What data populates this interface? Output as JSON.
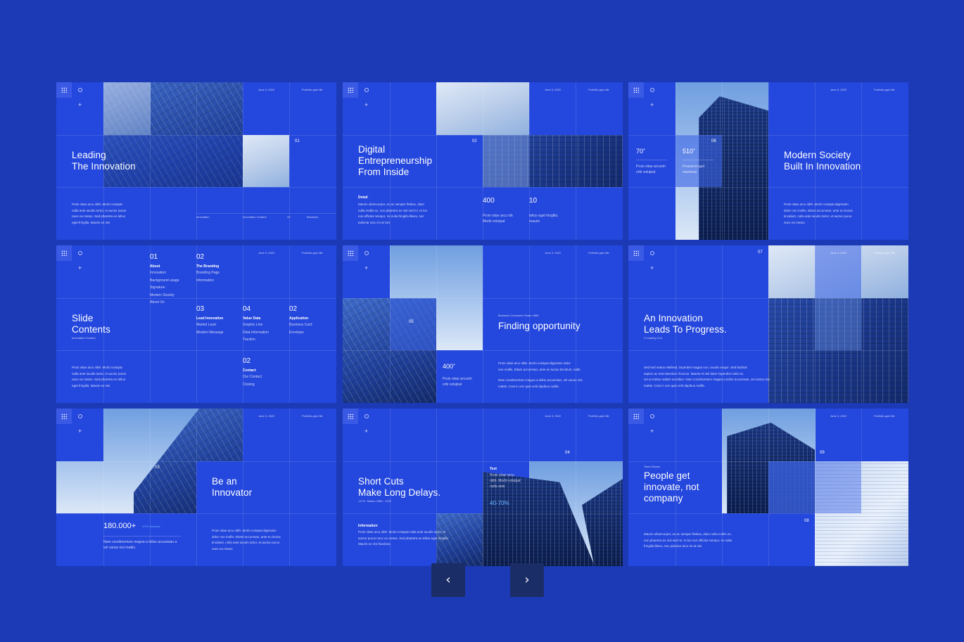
{
  "slides_common": {
    "date": "June 3, 2022",
    "file": "Portfolio.pptx file"
  },
  "slide1": {
    "title": "Leading\nThe Innovation",
    "num": "01",
    "body": "Proin vitae arcu nibh. Morbi volutpat\nnulla ante iaculis tortor, et auctor purus\nnunc eu metus. Sed pharetra eu tellus\neget fringilla. Mauris ex nisi",
    "footer": [
      "Innovation",
      "Innovation Content",
      "33",
      "Business"
    ]
  },
  "slide2": {
    "title": "Digital\nEntrepreneurship\nFrom Inside",
    "num": "02",
    "label": "Detail",
    "body": "Mauris ullamcorper, ex ac semper finibus, diam\nnulla mollis ex, non pharetra ex nisl sed mi. In leo\nnon efficitur tempor, mi nulla fringilla libero, nec\npulvinar arcu mi at nisi.",
    "stat1": "400",
    "stat1_text": "Proin vitae arcu nib\nMorbi volutpat",
    "stat2": "10",
    "stat2_text": "tellus eget fringilla.\nmauris"
  },
  "slide3": {
    "title": "Modern Society\nBuilt In Innovation",
    "num": "06",
    "stat1": "70",
    "stat1_text": "Proin vitae arcurnh\norbi volutpat",
    "stat2": "510",
    "stat2_text": "Praesent eget\nmaximus",
    "body": "Proin vitae arcu nibh. Morbi volutpat dignissim\ndolor non mollis. Etiam accumsan, ante eu luctus\ntincidunt, nulla ante iaculis tortor, et auctor purus\nnunc eu metus."
  },
  "slide4": {
    "title": "Slide\nContents",
    "subtitle": "Innovation Content",
    "body": "Proin vitae arcu nibh. Morbi volutpat\nnulla ante iaculis tortor, et auctor purus\nnunc eu metus. Sed pharetra eu tellus\neget fringilla. Mauris ex nisi",
    "toc": [
      {
        "num": "01",
        "head": "About",
        "items": "Innovation\nBackground usage\nSignature\nModern Society\nAbout Us"
      },
      {
        "num": "02",
        "head": "The Branding",
        "items": "Branding Page\nInformation"
      },
      {
        "num": "03",
        "head": "Lead Innovation",
        "items": "Market Lead\nModern Message"
      },
      {
        "num": "04",
        "head": "Value Data",
        "items": "Graphic Line\nData Information\nTraction"
      },
      {
        "num": "02",
        "head": "Application",
        "items": "Business Card\nEnvelope"
      },
      {
        "num": "02",
        "head": "Contact",
        "items": "Our Contact\nClosing"
      }
    ]
  },
  "slide5": {
    "title": "Finding opportunity",
    "kicker": "Business Consumer Share 1880",
    "num": "05",
    "stat": "400",
    "stat_text": "Proin vitae arcurnh\norbi volutpat",
    "body1": "Proin vitae arcu nibh. Morbi volutpat dignissim dolor\nnon mollis. Etiam accumsan, ante eu luctus tincidunt, nulla",
    "body2": "Nam condimentum magna a tellus accumsan, vel varius nisi\nmattis. Cras in orci quis velit dapibus mollis."
  },
  "slide6": {
    "title": "An Innovation\nLeads To Progress.",
    "subtitle": "// Leading 1111",
    "num": "07",
    "body": "Sed sed metus eleifend, imperdiet magna non, iaculis neque. Sed facilisis\nsapien ac erat interdum rhoncus. Mauris et nisl diam imperdiet nulla eu\nvel ut metus nullam eu tellus. Nam condimentum magna a tellus accumsan, vel varius nisi\nmattis. Cras in orci quis velit dapibus mollis."
  },
  "slide7": {
    "title": "Be an\nInnovator",
    "num": "03",
    "stat": "180.000+",
    "stat_note": "+27% Increase",
    "stat_text": "Nam condimentum magna a tellus accumsan a\nvel varius nisi mattis.",
    "body": "Proin vitae arcu nibh. Morbi volutpat dignissim\ndolor non mollis. Etiam accumsan, ante eu luctus\ntincidunt, nulla ante iaculis tortor, et auctor purus\nnunc eu metus."
  },
  "slide8": {
    "title": "Short Cuts\nMake Long Delays.",
    "subtitle": "J.R.R. Tolkien 1965 - 1970",
    "num": "04",
    "label": "Text",
    "label_body": "Proin vitae arcu\nnibh. Morbi volutpat\nnulla ante",
    "percent": "40-70%",
    "info_label": "Information",
    "info_body": "Proin vitae arcu nibh. Morbi volutpat nulla ante iaculis tortor, et\nauctor purus nunc eu metus. Sed pharetra eu tellus eget fringilla.\nMauris ex nisi faucibus."
  },
  "slide9": {
    "title": "People get\ninnovate, not\ncompany",
    "kicker": "Team Shown",
    "num1": "09",
    "num2": "08",
    "body": "Mauris ullamcorper, ex ac semper finibus, diam nulla mollis ex,\nnon pharetra ex nisl sed mi. In leo non efficitur tempor, mi nulla\nfringilla libero, nec pulvinar arcu mi at nisi."
  },
  "nav": {
    "prev": "‹",
    "next": "›"
  }
}
